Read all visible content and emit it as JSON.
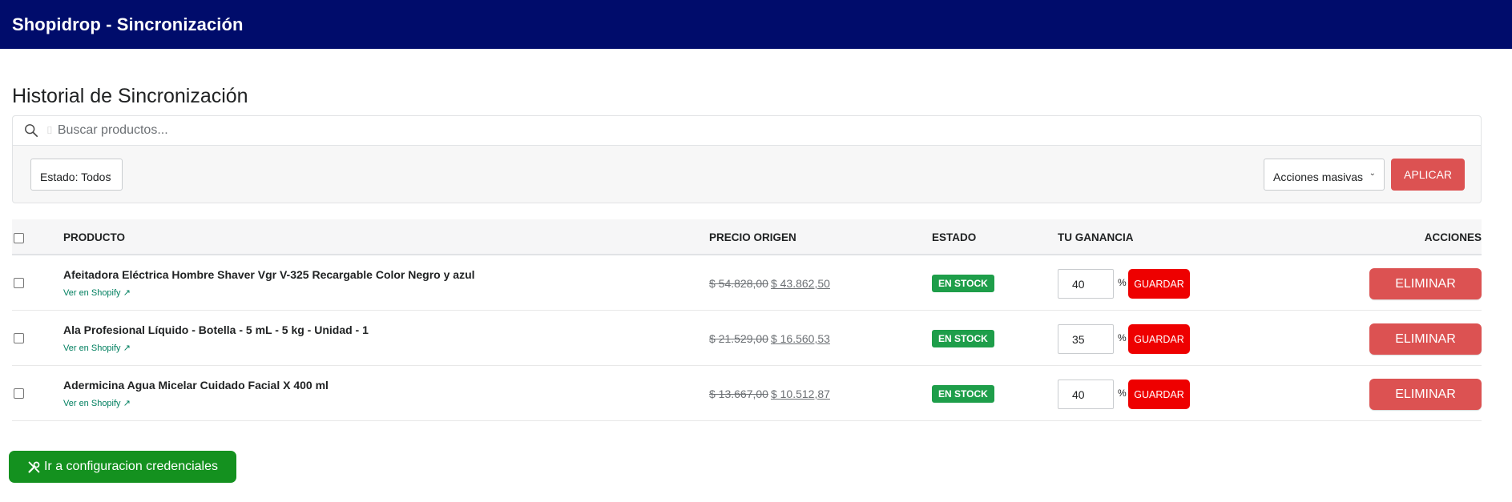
{
  "app": {
    "title": "Shopidrop - Sincronización"
  },
  "page": {
    "heading": "Historial de Sincronización"
  },
  "search": {
    "placeholder": "Buscar productos...",
    "glyph": "⌷",
    "icon": "search-icon"
  },
  "filters": {
    "estado_label": "Estado: Todos",
    "bulk_label": "Acciones masivas",
    "apply_label": "APLICAR"
  },
  "table": {
    "headers": {
      "producto": "PRODUCTO",
      "precio": "PRECIO ORIGEN",
      "estado": "ESTADO",
      "ganancia": "TU GANANCIA",
      "acciones": "ACCIONES"
    },
    "rows": [
      {
        "name": "Afeitadora Eléctrica Hombre Shaver Vgr V-325 Recargable Color Negro y azul",
        "link": "Ver en Shopify ↗",
        "old_price": "$ 54.828,00",
        "new_price": "$ 43.862,50",
        "status": "EN STOCK",
        "gain": "40",
        "pct": "%",
        "save": "GUARDAR",
        "delete": "ELIMINAR"
      },
      {
        "name": "Ala Profesional Líquido - Botella - 5 mL - 5 kg - Unidad - 1",
        "link": "Ver en Shopify ↗",
        "old_price": "$ 21.529,00",
        "new_price": "$ 16.560,53",
        "status": "EN STOCK",
        "gain": "35",
        "pct": "%",
        "save": "GUARDAR",
        "delete": "ELIMINAR"
      },
      {
        "name": "Adermicina Agua Micelar Cuidado Facial X 400 ml",
        "link": "Ver en Shopify ↗",
        "old_price": "$ 13.667,00",
        "new_price": "$ 10.512,87",
        "status": "EN STOCK",
        "gain": "40",
        "pct": "%",
        "save": "GUARDAR",
        "delete": "ELIMINAR"
      }
    ]
  },
  "footer": {
    "credentials_label": "Ir a configuracion credenciales",
    "icon": "tools-icon"
  },
  "colors": {
    "topbar": "#000c6b",
    "danger": "#dc5252",
    "save": "#ee0000",
    "stock_badge": "#1e9e4a",
    "credentials_button": "#14911f"
  }
}
